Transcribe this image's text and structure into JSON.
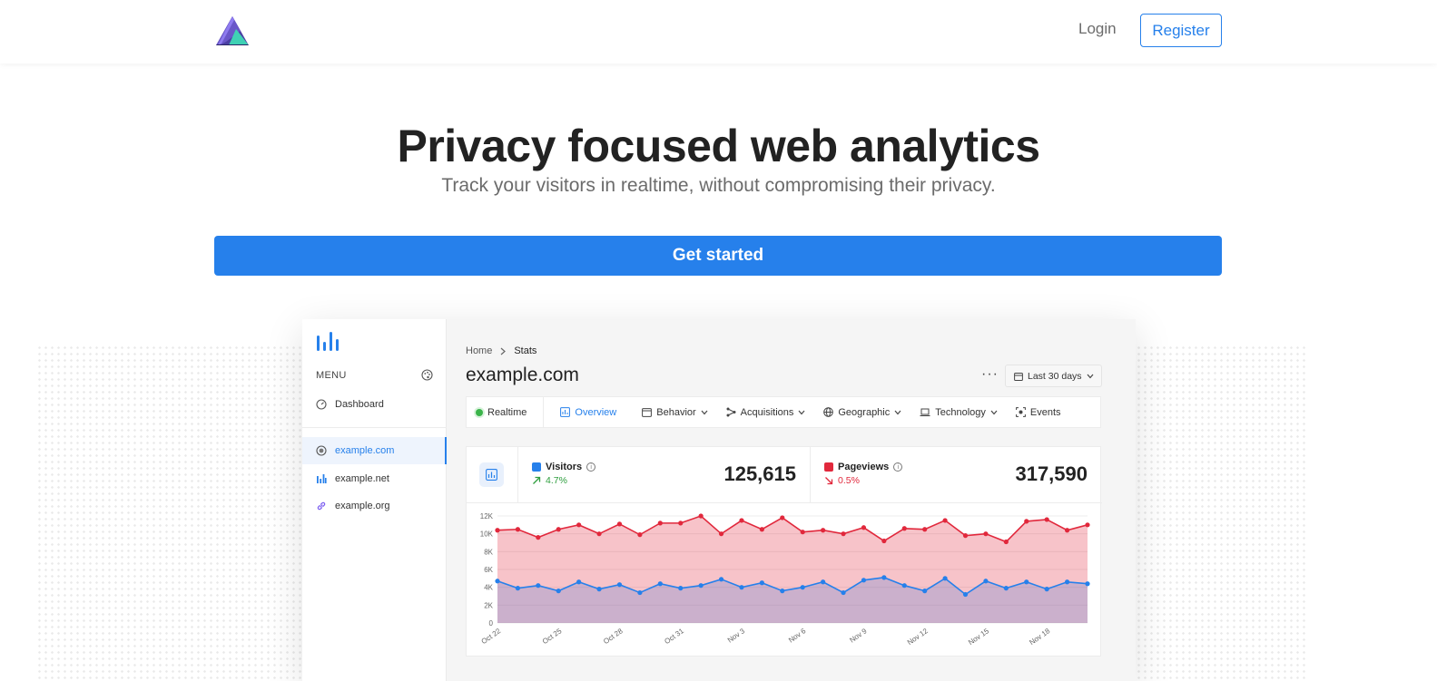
{
  "header": {
    "login_label": "Login",
    "register_label": "Register"
  },
  "hero": {
    "title": "Privacy focused web analytics",
    "subtitle": "Track your visitors in realtime, without compromising their privacy.",
    "cta_label": "Get started"
  },
  "app": {
    "sidebar": {
      "menu_label": "MENU",
      "dashboard_label": "Dashboard",
      "sites": [
        {
          "label": "example.com",
          "icon": "globe-icon",
          "active": true
        },
        {
          "label": "example.net",
          "icon": "bar-chart-icon",
          "active": false
        },
        {
          "label": "example.org",
          "icon": "link-icon",
          "active": false
        }
      ]
    },
    "breadcrumb": {
      "home": "Home",
      "current": "Stats"
    },
    "site_title": "example.com",
    "more_label": "···",
    "date_range": "Last 30 days",
    "tabs": {
      "realtime": "Realtime",
      "overview": "Overview",
      "behavior": "Behavior",
      "acquisitions": "Acquisitions",
      "geographic": "Geographic",
      "technology": "Technology",
      "events": "Events"
    },
    "metrics": {
      "visitors": {
        "label": "Visitors",
        "change": "4.7%",
        "value": "125,615",
        "color": "#2680eb",
        "trend": "up",
        "trend_color": "#2e9e3e"
      },
      "pageviews": {
        "label": "Pageviews",
        "change": "0.5%",
        "value": "317,590",
        "color": "#e1283c",
        "trend": "down",
        "trend_color": "#e1283c"
      }
    }
  },
  "chart_data": {
    "type": "area",
    "x_tick_labels": [
      "Oct 22",
      "Oct 25",
      "Oct 28",
      "Oct 31",
      "Nov 3",
      "Nov 6",
      "Nov 9",
      "Nov 12",
      "Nov 15",
      "Nov 18"
    ],
    "y_tick_labels": [
      "0",
      "2K",
      "4K",
      "6K",
      "8K",
      "10K",
      "12K"
    ],
    "ylim": [
      0,
      12000
    ],
    "series": [
      {
        "name": "Pageviews",
        "color": "#e1283c",
        "values": [
          10400,
          10500,
          9600,
          10500,
          11000,
          10000,
          11100,
          9900,
          11200,
          11200,
          12000,
          10000,
          11500,
          10500,
          11800,
          10200,
          10400,
          10000,
          10700,
          9200,
          10600,
          10500,
          11500,
          9800,
          10000,
          9100,
          11400,
          11600,
          10400,
          11000
        ]
      },
      {
        "name": "Visitors",
        "color": "#2680eb",
        "values": [
          4700,
          3900,
          4200,
          3600,
          4600,
          3800,
          4300,
          3400,
          4400,
          3900,
          4200,
          4900,
          4000,
          4500,
          3600,
          4000,
          4600,
          3400,
          4800,
          5100,
          4200,
          3600,
          5000,
          3200,
          4700,
          3900,
          4600,
          3800,
          4600,
          4400
        ]
      }
    ],
    "grid": true
  }
}
